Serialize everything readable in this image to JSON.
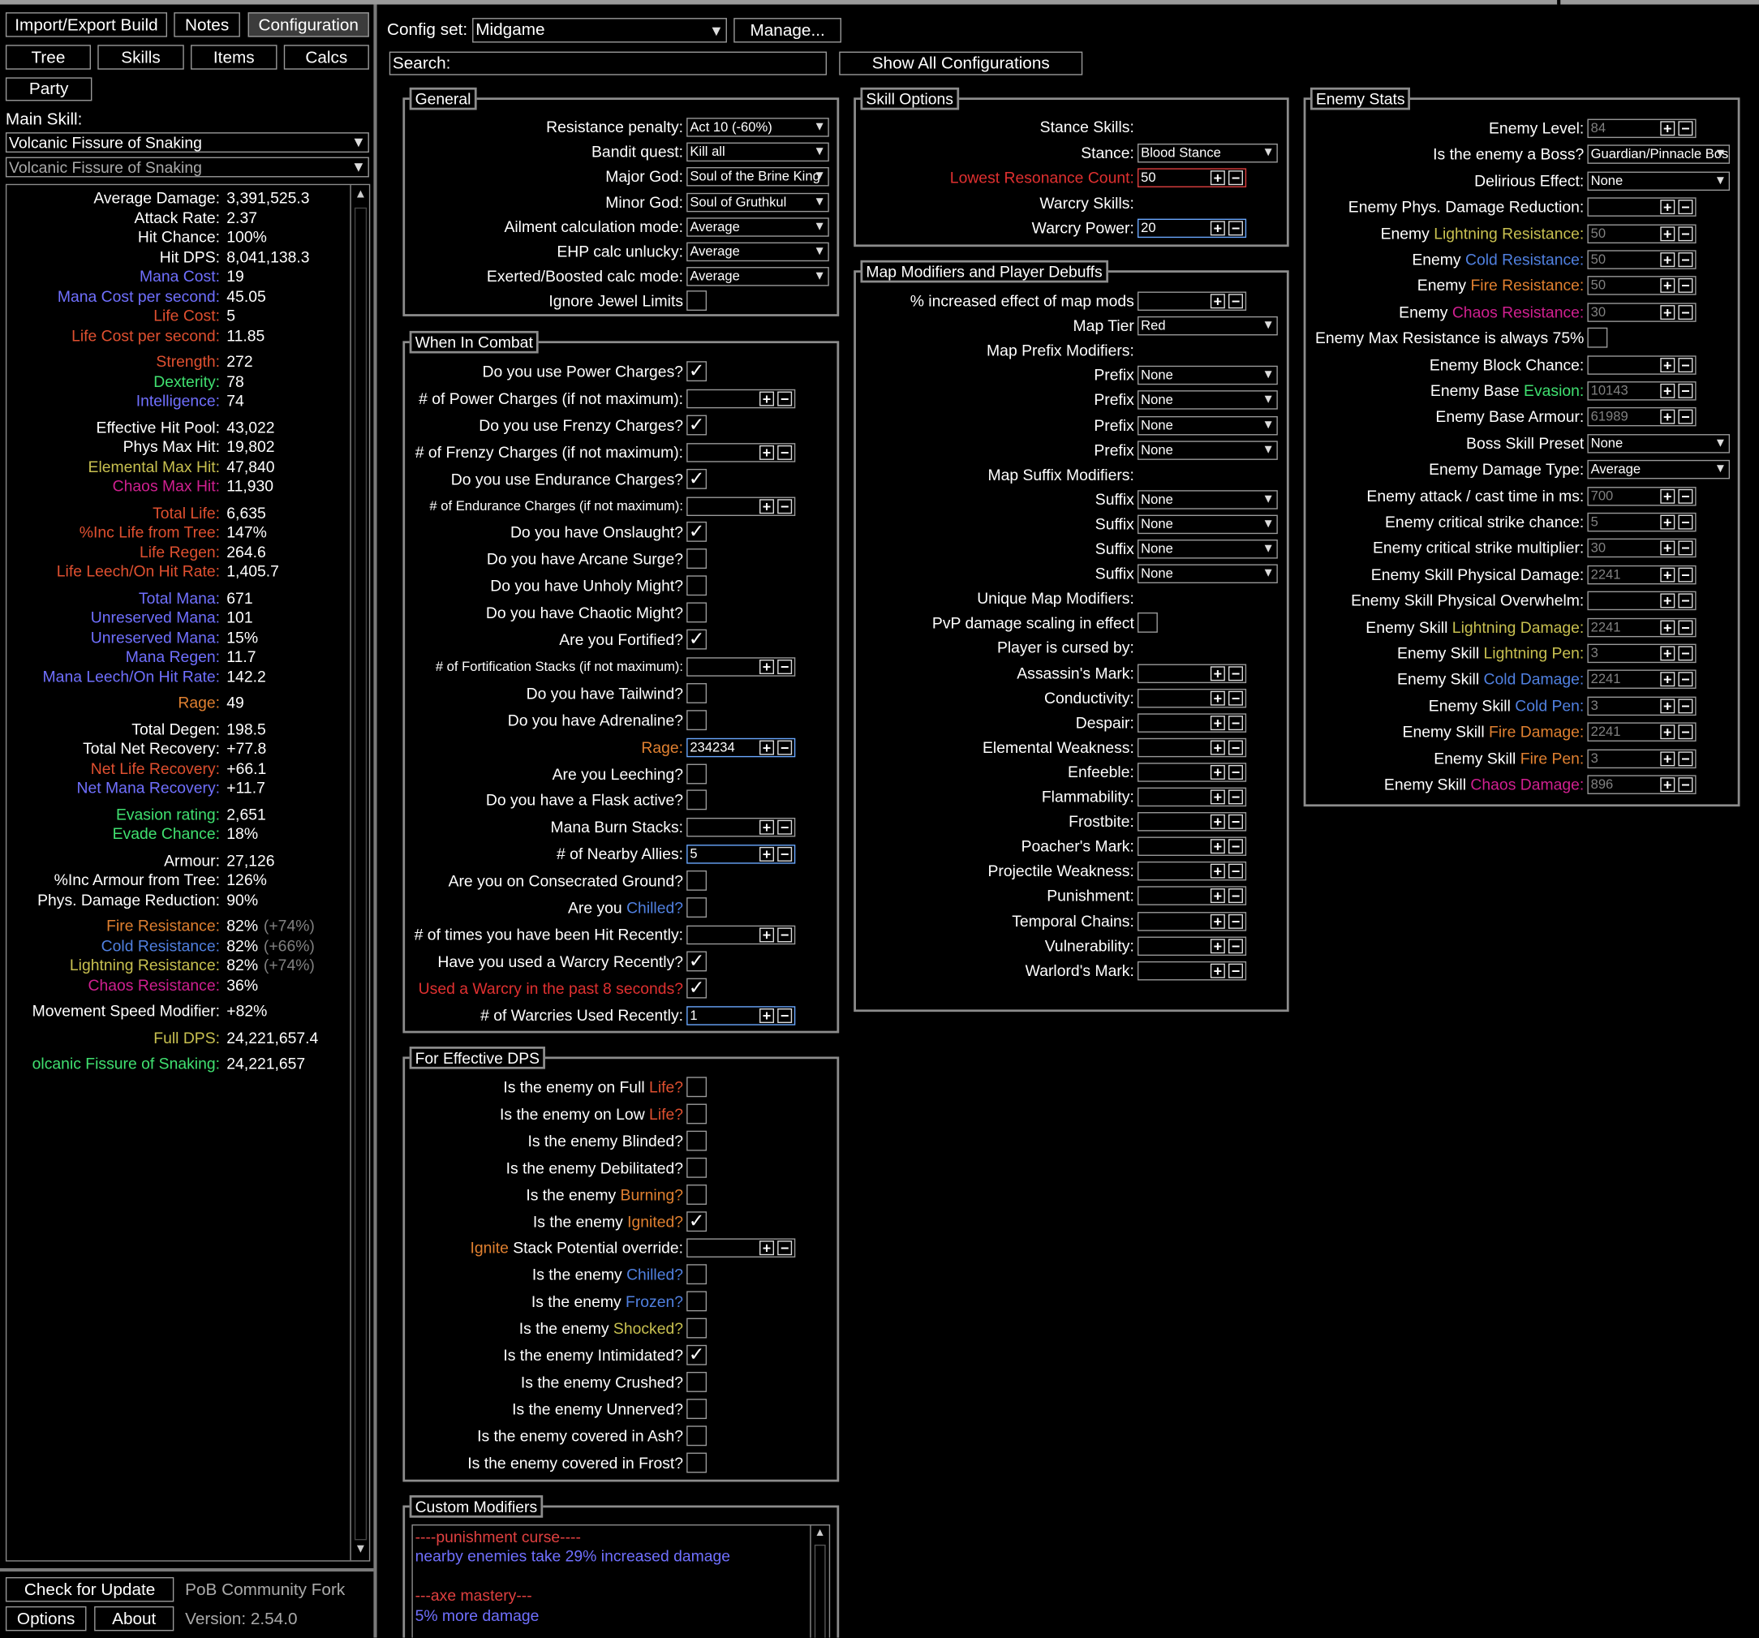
{
  "colors": {
    "mana": "#7070ff",
    "life": "#e05030",
    "str": "#e05030",
    "dex": "#40e070",
    "int": "#7070ff",
    "elem": "#c8c050",
    "chaos": "#d02090",
    "fire": "#e08030",
    "cold": "#5080e0",
    "lightning": "#c8c050",
    "rage": "#e08030",
    "evasion": "#40e070"
  },
  "topbar": {
    "import": "Import/Export Build",
    "notes": "Notes",
    "config": "Configuration",
    "tree": "Tree",
    "skills": "Skills",
    "items": "Items",
    "calcs": "Calcs",
    "party": "Party"
  },
  "main_skill": {
    "label": "Main Skill:",
    "skill": "Volcanic Fissure of Snaking",
    "part": "Volcanic Fissure of Snaking"
  },
  "stats": [
    {
      "l": "Average Damage:",
      "v": "3,391,525.3",
      "c": "#fff"
    },
    {
      "l": "Attack Rate:",
      "v": "2.37",
      "c": "#fff"
    },
    {
      "l": "Hit Chance:",
      "v": "100%",
      "c": "#fff"
    },
    {
      "l": "Hit DPS:",
      "v": "8,041,138.3",
      "c": "#fff"
    },
    {
      "l": "Mana Cost:",
      "v": "19",
      "c": "#7070ff"
    },
    {
      "l": "Mana Cost per second:",
      "v": "45.05",
      "c": "#7070ff"
    },
    {
      "l": "Life Cost:",
      "v": "5",
      "c": "#e05030"
    },
    {
      "l": "Life Cost per second:",
      "v": "11.85",
      "c": "#e05030"
    },
    {
      "l": "Strength:",
      "v": "272",
      "c": "#e05030",
      "gap": true
    },
    {
      "l": "Dexterity:",
      "v": "78",
      "c": "#40e070"
    },
    {
      "l": "Intelligence:",
      "v": "74",
      "c": "#7070ff"
    },
    {
      "l": "Effective Hit Pool:",
      "v": "43,022",
      "c": "#fff",
      "gap": true
    },
    {
      "l": "Phys Max Hit:",
      "v": "19,802",
      "c": "#fff"
    },
    {
      "l": "Elemental Max Hit:",
      "v": "47,840",
      "c": "#c8c050"
    },
    {
      "l": "Chaos Max Hit:",
      "v": "11,930",
      "c": "#d02090"
    },
    {
      "l": "Total Life:",
      "v": "6,635",
      "c": "#e05030",
      "gap": true
    },
    {
      "l": "%Inc Life from Tree:",
      "v": "147%",
      "c": "#e05030"
    },
    {
      "l": "Life Regen:",
      "v": "264.6",
      "c": "#e05030"
    },
    {
      "l": "Life Leech/On Hit Rate:",
      "v": "1,405.7",
      "c": "#e05030"
    },
    {
      "l": "Total Mana:",
      "v": "671",
      "c": "#7070ff",
      "gap": true
    },
    {
      "l": "Unreserved Mana:",
      "v": "101",
      "c": "#7070ff"
    },
    {
      "l": "Unreserved Mana:",
      "v": "15%",
      "c": "#7070ff"
    },
    {
      "l": "Mana Regen:",
      "v": "11.7",
      "c": "#7070ff"
    },
    {
      "l": "Mana Leech/On Hit Rate:",
      "v": "142.2",
      "c": "#7070ff"
    },
    {
      "l": "Rage:",
      "v": "49",
      "c": "#e08030",
      "gap": true
    },
    {
      "l": "Total Degen:",
      "v": "198.5",
      "c": "#fff",
      "gap": true
    },
    {
      "l": "Total Net Recovery:",
      "v": "+77.8",
      "c": "#fff"
    },
    {
      "l": "Net Life Recovery:",
      "v": "+66.1",
      "c": "#e05030"
    },
    {
      "l": "Net Mana Recovery:",
      "v": "+11.7",
      "c": "#7070ff"
    },
    {
      "l": "Evasion rating:",
      "v": "2,651",
      "c": "#40e070",
      "gap": true
    },
    {
      "l": "Evade Chance:",
      "v": "18%",
      "c": "#40e070"
    },
    {
      "l": "Armour:",
      "v": "27,126",
      "c": "#fff",
      "gap": true
    },
    {
      "l": "%Inc Armour from Tree:",
      "v": "126%",
      "c": "#fff"
    },
    {
      "l": "Phys. Damage Reduction:",
      "v": "90%",
      "c": "#fff"
    },
    {
      "l": "Fire Resistance:",
      "v": "82%",
      "x": "(+74%)",
      "c": "#e08030",
      "gap": true
    },
    {
      "l": "Cold Resistance:",
      "v": "82%",
      "x": "(+66%)",
      "c": "#5080e0"
    },
    {
      "l": "Lightning Resistance:",
      "v": "82%",
      "x": "(+74%)",
      "c": "#c8c050"
    },
    {
      "l": "Chaos Resistance:",
      "v": "36%",
      "c": "#d02090"
    },
    {
      "l": "Movement Speed Modifier:",
      "v": "+82%",
      "c": "#fff",
      "gap": true
    },
    {
      "l": "Full DPS:",
      "v": "24,221,657.4",
      "c": "#c8c050",
      "gap": true
    },
    {
      "l": "olcanic Fissure of Snaking:",
      "v": "24,221,657",
      "c": "#40e070",
      "gap": true
    }
  ],
  "bottom": {
    "update": "Check for Update",
    "fork": "PoB Community Fork",
    "options": "Options",
    "about": "About",
    "version": "Version: 2.54.0"
  },
  "config": {
    "label": "Config set:",
    "value": "Midgame",
    "manage": "Manage...",
    "search_label": "Search:",
    "show_all": "Show All Configurations"
  },
  "general": {
    "title": "General",
    "rows": [
      {
        "l": "Resistance penalty:",
        "t": "dd",
        "v": "Act 10 (-60%)"
      },
      {
        "l": "Bandit quest:",
        "t": "dd",
        "v": "Kill all"
      },
      {
        "l": "Major God:",
        "t": "dd",
        "v": "Soul of the Brine King"
      },
      {
        "l": "Minor God:",
        "t": "dd",
        "v": "Soul of Gruthkul"
      },
      {
        "l": "Ailment calculation mode:",
        "t": "dd",
        "v": "Average"
      },
      {
        "l": "EHP calc unlucky:",
        "t": "dd",
        "v": "Average"
      },
      {
        "l": "Exerted/Boosted calc mode:",
        "t": "dd",
        "v": "Average"
      },
      {
        "l": "Ignore Jewel Limits",
        "t": "cb",
        "v": ""
      }
    ]
  },
  "combat": {
    "title": "When In Combat",
    "rows": [
      {
        "l": "Do you use Power Charges?",
        "t": "cb",
        "v": "✓"
      },
      {
        "l": "# of Power Charges (if not maximum):",
        "t": "num",
        "v": ""
      },
      {
        "l": "Do you use Frenzy Charges?",
        "t": "cb",
        "v": "✓"
      },
      {
        "l": "# of Frenzy Charges (if not maximum):",
        "t": "num",
        "v": ""
      },
      {
        "l": "Do you use Endurance Charges?",
        "t": "cb",
        "v": "✓"
      },
      {
        "l": "# of Endurance Charges (if not maximum):",
        "t": "num",
        "v": "",
        "small": true
      },
      {
        "l": "Do you have Onslaught?",
        "t": "cb",
        "v": "✓"
      },
      {
        "l": "Do you have Arcane Surge?",
        "t": "cb",
        "v": ""
      },
      {
        "l": "Do you have Unholy Might?",
        "t": "cb",
        "v": ""
      },
      {
        "l": "Do you have Chaotic Might?",
        "t": "cb",
        "v": ""
      },
      {
        "l": "Are you Fortified?",
        "t": "cb",
        "v": "✓"
      },
      {
        "l": "# of Fortification Stacks (if not maximum):",
        "t": "num",
        "v": "",
        "small": true
      },
      {
        "l": "Do you have Tailwind?",
        "t": "cb",
        "v": ""
      },
      {
        "l": "Do you have Adrenaline?",
        "t": "cb",
        "v": ""
      },
      {
        "l": "Rage:",
        "t": "num",
        "v": "234234",
        "c": "#e08030",
        "hl": true
      },
      {
        "l": "Are you Leeching?",
        "t": "cb",
        "v": ""
      },
      {
        "l": "Do you have a Flask active?",
        "t": "cb",
        "v": ""
      },
      {
        "l": "Mana Burn Stacks:",
        "t": "num",
        "v": ""
      },
      {
        "l": "# of Nearby Allies:",
        "t": "num",
        "v": "5",
        "hl": true
      },
      {
        "l": "Are you on Consecrated Ground?",
        "t": "cb",
        "v": ""
      },
      {
        "l": "Are you ",
        "k": "Chilled?",
        "kc": "#5080e0",
        "t": "cb",
        "v": ""
      },
      {
        "l": "# of times you have been Hit Recently:",
        "t": "num",
        "v": ""
      },
      {
        "l": "Have you used a Warcry Recently?",
        "t": "cb",
        "v": "✓"
      },
      {
        "l": "Used a Warcry in the past 8 seconds?",
        "t": "cb",
        "v": "✓",
        "c": "#e03030"
      },
      {
        "l": "# of Warcries Used Recently:",
        "t": "num",
        "v": "1",
        "hl": true
      }
    ]
  },
  "effdps": {
    "title": "For Effective DPS",
    "rows": [
      {
        "l": "Is the enemy on Full ",
        "k": "Life?",
        "kc": "#e05030",
        "t": "cb",
        "v": ""
      },
      {
        "l": "Is the enemy on Low ",
        "k": "Life?",
        "kc": "#e05030",
        "t": "cb",
        "v": ""
      },
      {
        "l": "Is the enemy Blinded?",
        "t": "cb",
        "v": ""
      },
      {
        "l": "Is the enemy Debilitated?",
        "t": "cb",
        "v": ""
      },
      {
        "l": "Is the enemy ",
        "k": "Burning?",
        "kc": "#e08030",
        "t": "cb",
        "v": ""
      },
      {
        "l": "Is the enemy ",
        "k": "Ignited?",
        "kc": "#e08030",
        "t": "cb",
        "v": "✓"
      },
      {
        "p": "Ignite",
        "pc": "#e08030",
        "l": " Stack Potential override:",
        "t": "num",
        "v": ""
      },
      {
        "l": "Is the enemy ",
        "k": "Chilled?",
        "kc": "#5080e0",
        "t": "cb",
        "v": ""
      },
      {
        "l": "Is the enemy ",
        "k": "Frozen?",
        "kc": "#5080e0",
        "t": "cb",
        "v": ""
      },
      {
        "l": "Is the enemy ",
        "k": "Shocked?",
        "kc": "#c8c050",
        "t": "cb",
        "v": ""
      },
      {
        "l": "Is the enemy Intimidated?",
        "t": "cb",
        "v": "✓"
      },
      {
        "l": "Is the enemy Crushed?",
        "t": "cb",
        "v": ""
      },
      {
        "l": "Is the enemy Unnerved?",
        "t": "cb",
        "v": ""
      },
      {
        "l": "Is the enemy covered in Ash?",
        "t": "cb",
        "v": ""
      },
      {
        "l": "Is the enemy covered in Frost?",
        "t": "cb",
        "v": ""
      }
    ]
  },
  "custom": {
    "title": "Custom Modifiers",
    "lines": [
      {
        "t": "----punishment curse----",
        "c": "#e04040"
      },
      {
        "t": "nearby enemies take 29% increased damage",
        "c": "#7070ff"
      },
      {
        "t": "",
        "c": "#fff"
      },
      {
        "t": "---axe mastery---",
        "c": "#e04040"
      },
      {
        "t": "5% more damage",
        "c": "#7070ff"
      }
    ]
  },
  "skillopts": {
    "title": "Skill Options",
    "rows": [
      {
        "l": "Stance Skills:",
        "t": "none",
        "v": ""
      },
      {
        "l": "Stance:",
        "t": "dd",
        "v": "Blood Stance"
      },
      {
        "l": "Lowest Resonance Count:",
        "t": "num",
        "v": "50",
        "c": "#e03030",
        "red": true
      },
      {
        "l": "Warcry Skills:",
        "t": "none",
        "v": ""
      },
      {
        "l": "Warcry Power:",
        "t": "num",
        "v": "20",
        "hl": true
      }
    ]
  },
  "mapmods": {
    "title": "Map Modifiers and Player Debuffs",
    "rows": [
      {
        "l": "% increased effect of map mods",
        "t": "num",
        "v": ""
      },
      {
        "l": "Map Tier",
        "t": "dd",
        "v": "Red"
      },
      {
        "l": "Map Prefix Modifiers:",
        "t": "none",
        "v": ""
      },
      {
        "l": "Prefix",
        "t": "dd",
        "v": "None"
      },
      {
        "l": "Prefix",
        "t": "dd",
        "v": "None"
      },
      {
        "l": "Prefix",
        "t": "dd",
        "v": "None"
      },
      {
        "l": "Prefix",
        "t": "dd",
        "v": "None"
      },
      {
        "l": "Map Suffix Modifiers:",
        "t": "none",
        "v": ""
      },
      {
        "l": "Suffix",
        "t": "dd",
        "v": "None"
      },
      {
        "l": "Suffix",
        "t": "dd",
        "v": "None"
      },
      {
        "l": "Suffix",
        "t": "dd",
        "v": "None"
      },
      {
        "l": "Suffix",
        "t": "dd",
        "v": "None"
      },
      {
        "l": "Unique Map Modifiers:",
        "t": "none",
        "v": ""
      },
      {
        "l": "PvP damage scaling in effect",
        "t": "cb",
        "v": ""
      },
      {
        "l": "Player is cursed by:",
        "t": "none",
        "v": ""
      },
      {
        "l": "Assassin's Mark:",
        "t": "num",
        "v": ""
      },
      {
        "l": "Conductivity:",
        "t": "num",
        "v": ""
      },
      {
        "l": "Despair:",
        "t": "num",
        "v": ""
      },
      {
        "l": "Elemental Weakness:",
        "t": "num",
        "v": ""
      },
      {
        "l": "Enfeeble:",
        "t": "num",
        "v": ""
      },
      {
        "l": "Flammability:",
        "t": "num",
        "v": ""
      },
      {
        "l": "Frostbite:",
        "t": "num",
        "v": ""
      },
      {
        "l": "Poacher's Mark:",
        "t": "num",
        "v": ""
      },
      {
        "l": "Projectile Weakness:",
        "t": "num",
        "v": ""
      },
      {
        "l": "Punishment:",
        "t": "num",
        "v": ""
      },
      {
        "l": "Temporal Chains:",
        "t": "num",
        "v": ""
      },
      {
        "l": "Vulnerability:",
        "t": "num",
        "v": ""
      },
      {
        "l": "Warlord's Mark:",
        "t": "num",
        "v": ""
      }
    ]
  },
  "enemy": {
    "title": "Enemy Stats",
    "rows": [
      {
        "l": "Enemy Level:",
        "t": "num",
        "v": "84",
        "dim": true
      },
      {
        "l": "Is the enemy a Boss?",
        "t": "dd",
        "v": "Guardian/Pinnacle Boss"
      },
      {
        "l": "Delirious Effect:",
        "t": "dd",
        "v": "None"
      },
      {
        "l": "Enemy Phys. Damage Reduction:",
        "t": "num",
        "v": ""
      },
      {
        "l": "Enemy ",
        "k": "Lightning Resistance:",
        "kc": "#c8c050",
        "t": "num",
        "v": "50",
        "dim": true
      },
      {
        "l": "Enemy ",
        "k": "Cold Resistance:",
        "kc": "#5080e0",
        "t": "num",
        "v": "50",
        "dim": true
      },
      {
        "l": "Enemy ",
        "k": "Fire Resistance:",
        "kc": "#e08030",
        "t": "num",
        "v": "50",
        "dim": true
      },
      {
        "l": "Enemy ",
        "k": "Chaos Resistance:",
        "kc": "#d02090",
        "t": "num",
        "v": "30",
        "dim": true
      },
      {
        "l": "Enemy Max Resistance is always 75%",
        "t": "cb",
        "v": ""
      },
      {
        "l": "Enemy Block Chance:",
        "t": "num",
        "v": ""
      },
      {
        "l": "Enemy Base ",
        "k": "Evasion:",
        "kc": "#40e070",
        "t": "num",
        "v": "10143",
        "dim": true
      },
      {
        "l": "Enemy Base Armour:",
        "t": "num",
        "v": "61989",
        "dim": true
      },
      {
        "l": "Boss Skill Preset",
        "t": "dd",
        "v": "None"
      },
      {
        "l": "Enemy Damage Type:",
        "t": "dd",
        "v": "Average"
      },
      {
        "l": "Enemy attack / cast time in ms:",
        "t": "num",
        "v": "700",
        "dim": true
      },
      {
        "l": "Enemy critical strike chance:",
        "t": "num",
        "v": "5",
        "dim": true
      },
      {
        "l": "Enemy critical strike multiplier:",
        "t": "num",
        "v": "30",
        "dim": true
      },
      {
        "l": "Enemy Skill Physical Damage:",
        "t": "num",
        "v": "2241",
        "dim": true
      },
      {
        "l": "Enemy Skill Physical Overwhelm:",
        "t": "num",
        "v": ""
      },
      {
        "l": "Enemy Skill ",
        "k": "Lightning Damage:",
        "kc": "#c8c050",
        "t": "num",
        "v": "2241",
        "dim": true
      },
      {
        "l": "Enemy Skill ",
        "k": "Lightning Pen:",
        "kc": "#c8c050",
        "t": "num",
        "v": "3",
        "dim": true
      },
      {
        "l": "Enemy Skill ",
        "k": "Cold Damage:",
        "kc": "#5080e0",
        "t": "num",
        "v": "2241",
        "dim": true
      },
      {
        "l": "Enemy Skill ",
        "k": "Cold Pen:",
        "kc": "#5080e0",
        "t": "num",
        "v": "3",
        "dim": true
      },
      {
        "l": "Enemy Skill ",
        "k": "Fire Damage:",
        "kc": "#e08030",
        "t": "num",
        "v": "2241",
        "dim": true
      },
      {
        "l": "Enemy Skill ",
        "k": "Fire Pen:",
        "kc": "#e08030",
        "t": "num",
        "v": "3",
        "dim": true
      },
      {
        "l": "Enemy Skill ",
        "k": "Chaos Damage:",
        "kc": "#d02090",
        "t": "num",
        "v": "896",
        "dim": true
      }
    ]
  },
  "glyphs": {
    "plus": "+",
    "minus": "−",
    "arrow": "▼",
    "up": "▲"
  }
}
